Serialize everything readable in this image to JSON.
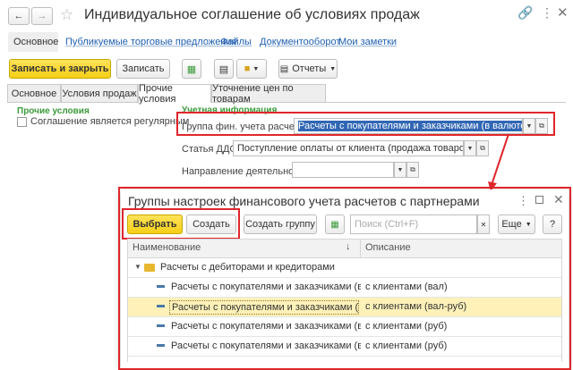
{
  "window": {
    "title": "Индивидуальное соглашение об условиях продаж"
  },
  "nav_links": [
    "Основное",
    "Публикуемые торговые предложения",
    "Файлы",
    "Документооборот",
    "Мои заметки"
  ],
  "toolbar": {
    "save_close": "Записать и закрыть",
    "save": "Записать",
    "reports": "Отчеты"
  },
  "tabs": [
    "Основное",
    "Условия продаж",
    "Прочие условия",
    "Уточнение цен по товарам"
  ],
  "left_group": {
    "title": "Прочие условия",
    "checkbox_label": "Соглашение является регулярным"
  },
  "accounting": {
    "header": "Учетная информация",
    "group_label": "Группа фин. учета расчетов:",
    "group_value": "Расчеты с покупателями и заказчиками (в валюте, оплата",
    "dds_label": "Статья ДДС:",
    "dds_value": "Поступление оплаты от клиента (продажа товаров, работ, у",
    "direction_label": "Направление деятельности:",
    "direction_value": ""
  },
  "dialog": {
    "title": "Группы настроек финансового учета расчетов с партнерами",
    "select": "Выбрать",
    "create": "Создать",
    "create_group": "Создать группу",
    "search_placeholder": "Поиск (Ctrl+F)",
    "more": "Еще",
    "help": "?",
    "col_name": "Наименование",
    "col_desc": "Описание",
    "group_row": "Расчеты с дебиторами и кредиторами",
    "rows": [
      {
        "name": "Расчеты с покупателями и заказчиками (в ва…",
        "desc": "с клиентами (вал)"
      },
      {
        "name": "Расчеты с покупателями и заказчиками (в ва…",
        "desc": "с клиентами (вал-руб)"
      },
      {
        "name": "Расчеты с покупателями и заказчиками (в ру…",
        "desc": "с клиентами (руб)"
      },
      {
        "name": "Расчеты с покупателями и заказчиками (в ру…",
        "desc": "с клиентами (руб)"
      }
    ]
  },
  "colors": {
    "highlight_red": "#e0262b",
    "selection": "#fff1b8",
    "accent_yellow": "#f5cf16",
    "value_highlight": "#3167b5"
  }
}
